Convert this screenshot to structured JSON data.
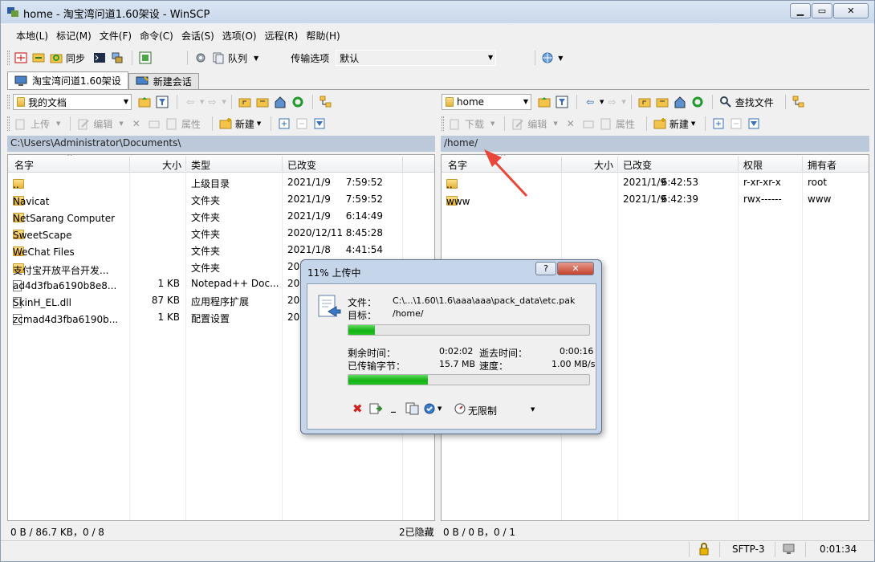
{
  "window": {
    "title": "home - 淘宝湾问道1.60架设 - WinSCP"
  },
  "menu": [
    "本地(L)",
    "标记(M)",
    "文件(F)",
    "命令(C)",
    "会话(S)",
    "选项(O)",
    "远程(R)",
    "帮助(H)"
  ],
  "toolbar": {
    "sync_label": "同步",
    "queue_label": "队列",
    "transfer_label": "传输选项",
    "transfer_value": "默认"
  },
  "tabs": {
    "session": "淘宝湾问道1.60架设",
    "new_session": "新建会话"
  },
  "local": {
    "location": "我的文档",
    "upload_label": "上传",
    "edit_label": "编辑",
    "props_label": "属性",
    "new_label": "新建",
    "path": "C:\\Users\\Administrator\\Documents\\",
    "columns": [
      "名字",
      "大小",
      "类型",
      "已改变"
    ],
    "rows": [
      {
        "name": "..",
        "size": "",
        "type": "上级目录",
        "date": "2021/1/9",
        "time": "7:59:52",
        "icon": "folder-up"
      },
      {
        "name": "Navicat",
        "size": "",
        "type": "文件夹",
        "date": "2021/1/9",
        "time": "7:59:52",
        "icon": "folder"
      },
      {
        "name": "NetSarang Computer",
        "size": "",
        "type": "文件夹",
        "date": "2021/1/9",
        "time": "6:14:49",
        "icon": "folder"
      },
      {
        "name": "SweetScape",
        "size": "",
        "type": "文件夹",
        "date": "2020/12/11",
        "time": "8:45:28",
        "icon": "folder"
      },
      {
        "name": "WeChat Files",
        "size": "",
        "type": "文件夹",
        "date": "2021/1/8",
        "time": "4:41:54",
        "icon": "folder"
      },
      {
        "name": "支付宝开放平台开发...",
        "size": "",
        "type": "文件夹",
        "date": "202",
        "time": "",
        "icon": "folder"
      },
      {
        "name": "ad4d3fba6190b8e8...",
        "size": "1 KB",
        "type": "Notepad++ Doc...",
        "date": "202",
        "time": "",
        "icon": "file-text"
      },
      {
        "name": "SkinH_EL.dll",
        "size": "87 KB",
        "type": "应用程序扩展",
        "date": "202",
        "time": "",
        "icon": "file-dll"
      },
      {
        "name": "zcmad4d3fba6190b...",
        "size": "1 KB",
        "type": "配置设置",
        "date": "202",
        "time": "",
        "icon": "file-config"
      }
    ],
    "status": "0 B / 86.7 KB，0 / 8"
  },
  "remote": {
    "location": "home",
    "download_label": "下载",
    "edit_label": "编辑",
    "props_label": "属性",
    "new_label": "新建",
    "find_label": "查找文件",
    "path": "/home/",
    "columns": [
      "名字",
      "大小",
      "已改变",
      "权限",
      "拥有者"
    ],
    "rows": [
      {
        "name": "..",
        "size": "",
        "date": "2021/1/9",
        "time": "6:42:53",
        "rights": "r-xr-xr-x",
        "owner": "root",
        "icon": "folder-up"
      },
      {
        "name": "www",
        "size": "",
        "date": "2021/1/9",
        "time": "6:42:39",
        "rights": "rwx------",
        "owner": "www",
        "icon": "folder"
      }
    ],
    "status_hidden": "2已隐藏",
    "status": "0 B / 0 B，0 / 1"
  },
  "bottom": {
    "protocol": "SFTP-3",
    "elapsed": "0:01:34"
  },
  "dialog": {
    "title": "11% 上传中",
    "file_label": "文件：",
    "file_value": "C:\\...\\1.60\\1.6\\aaa\\aaa\\pack_data\\etc.pak",
    "target_label": "目标：",
    "target_value": "/home/",
    "file_progress": 0.11,
    "remaining_label": "剩余时间：",
    "remaining_value": "0:02:02",
    "elapsed_label": "逝去时间：",
    "elapsed_value": "0:00:16",
    "transferred_label": "已传输字节：",
    "transferred_value": "15.7 MB",
    "speed_label": "速度：",
    "speed_value": "1.00 MB/s",
    "total_progress": 0.33,
    "speed_limit": "无限制",
    "help_btn": "?",
    "close_btn": "✕"
  },
  "colors": {
    "path_bar": "#bcc9da",
    "progress": "#16b316",
    "annotation_arrow": "#e8473a"
  }
}
